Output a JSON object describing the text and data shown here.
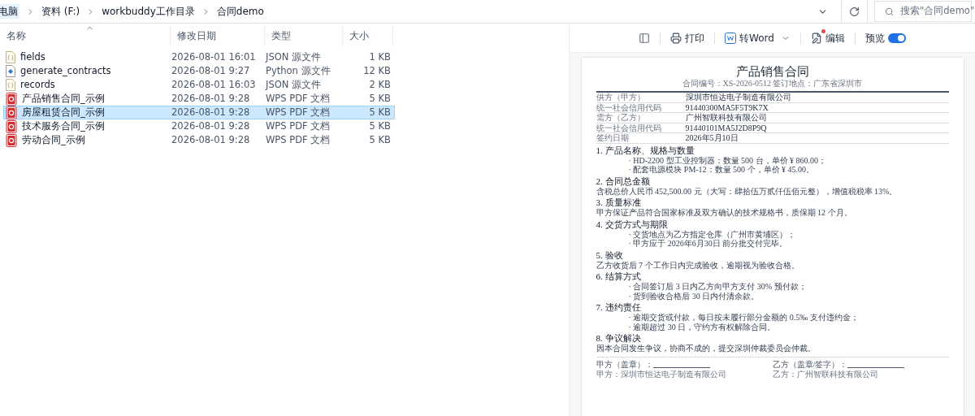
{
  "address_bar": {
    "breadcrumbs": [
      "电脑",
      "资料 (F:)",
      "workbuddy工作目录",
      "合同demo"
    ]
  },
  "search": {
    "placeholder": "搜索\"合同demo\""
  },
  "file_list": {
    "columns": [
      {
        "label": "名称",
        "sorted": true
      },
      {
        "label": "修改日期",
        "sorted": false
      },
      {
        "label": "类型",
        "sorted": false
      },
      {
        "label": "大小",
        "sorted": false
      }
    ],
    "rows": [
      {
        "kind": "json",
        "name": "fields",
        "modified": "2026-08-01 16:01",
        "type": "JSON 源文件",
        "size": "1 KB",
        "selected": false
      },
      {
        "kind": "python",
        "name": "generate_contracts",
        "modified": "2026-08-01 9:27",
        "type": "Python 源文件",
        "size": "12 KB",
        "selected": false
      },
      {
        "kind": "json",
        "name": "records",
        "modified": "2026-08-01 16:03",
        "type": "JSON 源文件",
        "size": "2 KB",
        "selected": false
      },
      {
        "kind": "pdf",
        "name": "产品销售合同_示例",
        "modified": "2026-08-01 9:28",
        "type": "WPS PDF 文档",
        "size": "5 KB",
        "selected": false
      },
      {
        "kind": "pdf",
        "name": "房屋租赁合同_示例",
        "modified": "2026-08-01 9:28",
        "type": "WPS PDF 文档",
        "size": "5 KB",
        "selected": true
      },
      {
        "kind": "pdf",
        "name": "技术服务合同_示例",
        "modified": "2026-08-01 9:28",
        "type": "WPS PDF 文档",
        "size": "5 KB",
        "selected": false
      },
      {
        "kind": "pdf",
        "name": "劳动合同_示例",
        "modified": "2026-08-01 9:28",
        "type": "WPS PDF 文档",
        "size": "5 KB",
        "selected": false
      }
    ]
  },
  "preview": {
    "toolbar": [
      {
        "kind": "panel"
      },
      {
        "kind": "print",
        "label": "打印"
      },
      {
        "kind": "word",
        "label": "转Word"
      },
      {
        "kind": "edit",
        "label": "编辑",
        "notification": true
      }
    ],
    "toggle": {
      "label": "预览",
      "on": true
    },
    "document": {
      "title": "产品销售合同",
      "subtitle": "合同编号：XS-2026-0512 签订地点：广东省深圳市",
      "parties": [
        {
          "label": "供方（甲方）",
          "value": "深圳市恒达电子制造有限公司"
        },
        {
          "label": "统一社会信用代码",
          "value": "91440300MA5F5T9K7X"
        },
        {
          "label": "需方（乙方）",
          "value": "广州智联科技有限公司"
        },
        {
          "label": "统一社会信用代码",
          "value": "91440101MA5J2D8P9Q"
        },
        {
          "label": "签约日期",
          "value": "2026年5月10日"
        }
      ],
      "sections": [
        {
          "heading": "1. 产品名称、规格与数量",
          "lines": [
            {
              "kind": "bullet",
              "text": "· HD-2200 型工业控制器：数量 500 台，单价 ¥ 860.00；"
            },
            {
              "kind": "bullet",
              "text": "· 配套电源模块 PM-12：数量 500 个，单价 ¥ 45.00。"
            }
          ]
        },
        {
          "heading": "2. 合同总金额",
          "lines": [
            {
              "kind": "text",
              "text": "含税总价人民币 452,500.00 元（大写：肆拾伍万贰仟伍佰元整），增值税税率 13%。"
            }
          ]
        },
        {
          "heading": "3. 质量标准",
          "lines": [
            {
              "kind": "text",
              "text": "甲方保证产品符合国家标准及双方确认的技术规格书，质保期 12 个月。"
            }
          ]
        },
        {
          "heading": "4. 交货方式与期限",
          "lines": [
            {
              "kind": "bullet",
              "text": "· 交货地点为乙方指定仓库（广州市黄埔区）；"
            },
            {
              "kind": "bullet",
              "text": "· 甲方应于 2026年6月30日 前分批交付完毕。"
            }
          ]
        },
        {
          "heading": "5. 验收",
          "lines": [
            {
              "kind": "text",
              "text": "乙方收货后 7 个工作日内完成验收，逾期视为验收合格。"
            }
          ]
        },
        {
          "heading": "6. 结算方式",
          "lines": [
            {
              "kind": "bullet",
              "text": "· 合同签订后 3 日内乙方向甲方支付 30% 预付款；"
            },
            {
              "kind": "bullet",
              "text": "· 货到验收合格后 30 日内付清余款。"
            }
          ]
        },
        {
          "heading": "7. 违约责任",
          "lines": [
            {
              "kind": "bullet",
              "text": "· 逾期交货或付款，每日按未履行部分金额的 0.5‰ 支付违约金；"
            },
            {
              "kind": "bullet",
              "text": "· 逾期超过 30 日，守约方有权解除合同。"
            }
          ]
        },
        {
          "heading": "8. 争议解决",
          "lines": [
            {
              "kind": "text",
              "text": "因本合同发生争议，协商不成的，提交深圳仲裁委员会仲裁。"
            }
          ]
        }
      ],
      "signatures": [
        {
          "label": "甲方（盖章）：",
          "name": "甲方：深圳市恒达电子制造有限公司"
        },
        {
          "label": "乙方（盖章/签字）：",
          "name": "乙方：广州智联科技有限公司"
        }
      ]
    }
  }
}
